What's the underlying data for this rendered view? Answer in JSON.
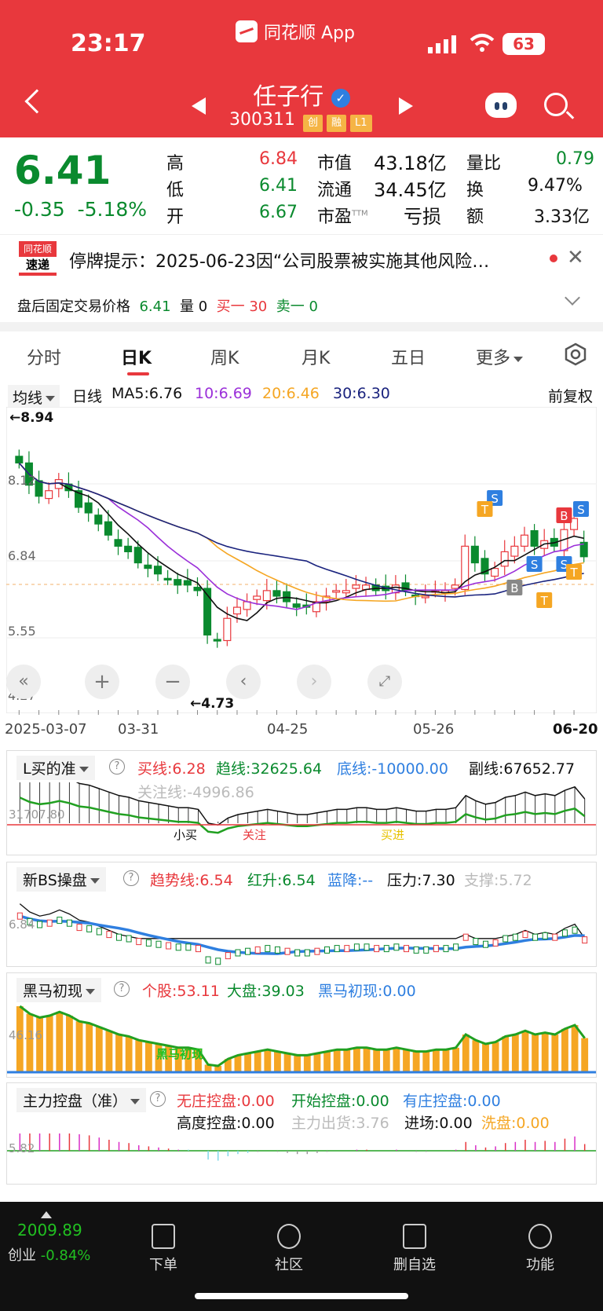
{
  "status_bar": {
    "time": "23:17",
    "app_name": "同花顺 App",
    "battery": "63"
  },
  "header": {
    "stock_name": "任子行",
    "stock_code": "300311",
    "tags": [
      "创",
      "融",
      "L1"
    ]
  },
  "quote": {
    "price": "6.41",
    "change": "-0.35",
    "change_pct": "-5.18%",
    "high_label": "高",
    "high": "6.84",
    "low_label": "低",
    "low": "6.41",
    "open_label": "开",
    "open": "6.67",
    "mcap_label": "市值",
    "mcap": "43.18亿",
    "float_label": "流通",
    "float": "34.45亿",
    "pe_label": "市盈",
    "pe_sup": "TTM",
    "pe": "亏损",
    "vr_label": "量比",
    "vr": "0.79",
    "turn_label": "换",
    "turn": "9.47%",
    "amt_label": "额",
    "amt": "3.33亿"
  },
  "notice": {
    "logo_top": "同花顺",
    "logo_bottom": "速递",
    "text": "停牌提示：2025-06-23因“公司股票被实施其他风险…"
  },
  "after_hours": {
    "label": "盘后固定交易价格",
    "price": "6.41",
    "vol_label": "量 0",
    "buy": "买一 30",
    "sell": "卖一 0"
  },
  "tabs": [
    "分时",
    "日K",
    "周K",
    "月K",
    "五日",
    "更多"
  ],
  "ma_bar": {
    "type": "均线",
    "period": "日线",
    "ma5": "MA5:6.76",
    "ma10": "10:6.69",
    "ma20": "20:6.46",
    "ma30": "30:6.30",
    "adjust": "前复权"
  },
  "chart_labels": {
    "high_mark": "←8.94",
    "low_mark": "←4.73",
    "y1": "8.12",
    "y2": "6.84",
    "y3": "5.55",
    "y4": "4.27"
  },
  "x_ticks": [
    "2025-03-07",
    "03-31",
    "04-25",
    "05-26",
    "06-20"
  ],
  "ind1": {
    "name": "L买的准",
    "buy": "买线:6.28",
    "trend": "趋线:32625.64",
    "bottom": "底线:-10000.00",
    "sub": "副线:67652.77",
    "watch": "关注线:-4996.86",
    "axis": "31707.80",
    "t1": "小买",
    "t2": "关注",
    "t3": "买进"
  },
  "ind2": {
    "name": "新BS操盘",
    "trend": "趋势线:6.54",
    "red": "红升:6.54",
    "blue": "蓝降:--",
    "press": "压力:7.30",
    "support": "支撑:5.72",
    "axis": "6.84"
  },
  "ind3": {
    "name": "黑马初现",
    "stock": "个股:53.11",
    "market": "大盘:39.03",
    "horse": "黑马初现:0.00",
    "axis": "46.16",
    "t1": "黑马初现"
  },
  "ind4": {
    "name": "主力控盘（准）",
    "a": "无庄控盘:0.00",
    "b": "开始控盘:0.00",
    "c": "有庄控盘:0.00",
    "d": "高度控盘:0.00",
    "e": "主力出货:3.76",
    "f": "进场:0.00",
    "g": "洗盘:0.00",
    "axis": "5.82"
  },
  "bottom_bar": {
    "index_value": "2009.89",
    "index_name": "创业",
    "index_change": "-0.84%",
    "nav": [
      "下单",
      "社区",
      "删自选",
      "功能"
    ]
  },
  "chart_data": {
    "type": "candlestick",
    "x": [
      "2025-03-07",
      "03-31",
      "04-25",
      "05-26",
      "06-20"
    ],
    "ylim": [
      4.27,
      8.94
    ],
    "high": 8.94,
    "low": 4.73,
    "last": {
      "close": 6.41,
      "high": 6.84,
      "low": 6.41,
      "open": 6.67
    },
    "series": [
      {
        "name": "MA5",
        "last": 6.76
      },
      {
        "name": "10",
        "last": 6.69
      },
      {
        "name": "20",
        "last": 6.46
      },
      {
        "name": "30",
        "last": 6.3
      }
    ],
    "close_approx": [
      8.1,
      7.7,
      7.5,
      7.6,
      7.8,
      7.6,
      7.3,
      7.2,
      7.0,
      6.8,
      6.6,
      6.5,
      6.3,
      6.2,
      6.1,
      6.0,
      5.9,
      5.9,
      5.8,
      5.0,
      4.9,
      5.3,
      5.5,
      5.6,
      5.7,
      5.8,
      5.7,
      5.6,
      5.5,
      5.5,
      5.6,
      5.7,
      5.8,
      5.8,
      5.9,
      5.9,
      5.8,
      5.8,
      5.9,
      5.8,
      5.7,
      5.7,
      5.8,
      5.8,
      5.9,
      6.6,
      6.3,
      6.1,
      6.2,
      6.5,
      6.6,
      6.8,
      6.6,
      6.7,
      6.6,
      6.9,
      7.1,
      6.41
    ]
  },
  "colors": {
    "brand_red": "#e8383d",
    "down_green": "#0a8a2e",
    "ma5": "#111111",
    "ma10": "#9b30d9",
    "ma20": "#f5a623",
    "ma30": "#1a237e"
  }
}
